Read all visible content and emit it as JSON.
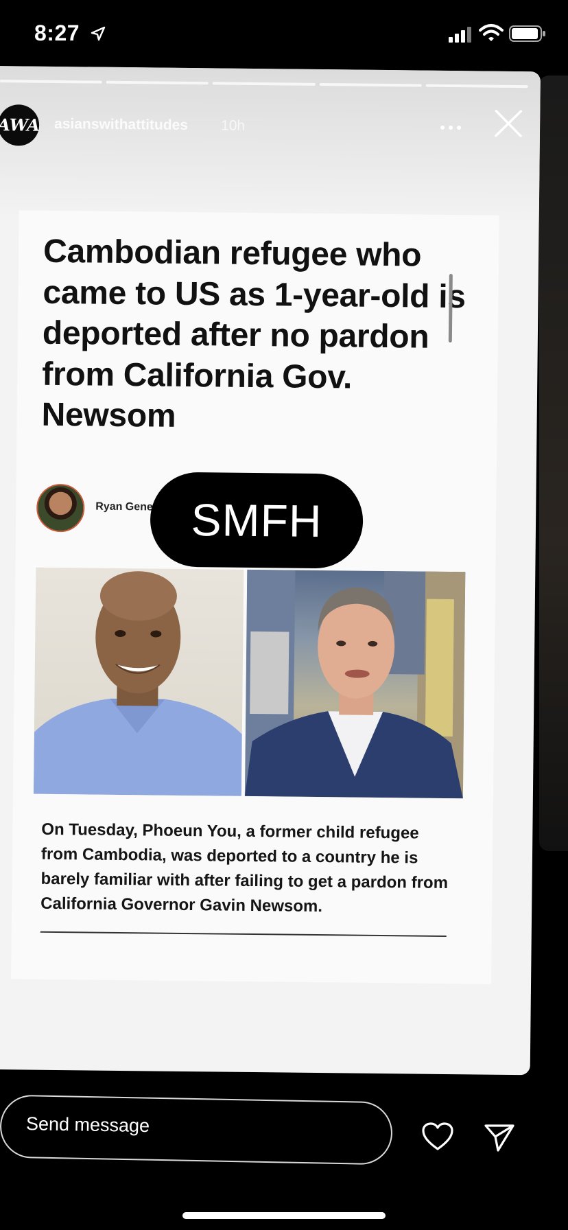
{
  "status_bar": {
    "time": "8:27",
    "icons": [
      "location-arrow-icon",
      "cellular-signal-icon",
      "wifi-icon",
      "battery-icon"
    ]
  },
  "story": {
    "progress_segments": 5,
    "account": {
      "username": "asianswithattitudes",
      "time_ago": "10h",
      "avatar_text": "AWA"
    },
    "sticker_text": "SMFH",
    "article": {
      "headline": "Cambodian refugee who came to US as 1-year-old is deported after no pardon from California Gov. Newsom",
      "author": "Ryan Gene",
      "body": "On Tuesday, Phoeun You, a former child refugee from Cambodia, was deported to a country he is barely familiar with after failing to get a pardon from California Governor Gavin Newsom."
    }
  },
  "reply_bar": {
    "placeholder": "Send message",
    "icons": [
      "heart-icon",
      "send-icon"
    ]
  },
  "colors": {
    "background": "#000000",
    "card": "#f3f3f3",
    "headline": "#111111"
  }
}
